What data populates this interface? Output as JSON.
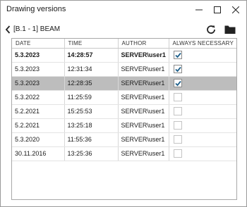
{
  "window": {
    "title": "Drawing versions"
  },
  "toolbar": {
    "breadcrumb": "[B.1 - 1] BEAM"
  },
  "table": {
    "headers": {
      "date": "DATE",
      "time": "TIME",
      "author": "AUTHOR",
      "always": "ALWAYS NECESSARY"
    },
    "rows": [
      {
        "date": "5.3.2023",
        "time": "14:28:57",
        "author": "SERVER\\user1",
        "always": true
      },
      {
        "date": "5.3.2023",
        "time": "12:31:34",
        "author": "SERVER\\user1",
        "always": true
      },
      {
        "date": "5.3.2023",
        "time": "12:28:35",
        "author": "SERVER\\user1",
        "always": true
      },
      {
        "date": "5.3.2022",
        "time": "11:25:59",
        "author": "SERVER\\user1",
        "always": false
      },
      {
        "date": "5.2.2021",
        "time": "15:25:53",
        "author": "SERVER\\user1",
        "always": false
      },
      {
        "date": "5.2.2021",
        "time": "13:25:18",
        "author": "SERVER\\user1",
        "always": false
      },
      {
        "date": "5.3.2020",
        "time": "11:55:36",
        "author": "SERVER\\user1",
        "always": false
      },
      {
        "date": "30.11.2016",
        "time": "13:25:36",
        "author": "SERVER\\user1",
        "always": false
      }
    ]
  },
  "colors": {
    "selected_row": "#bdbdbd",
    "check": "#1d5f8a",
    "border": "#a8a8a8"
  }
}
